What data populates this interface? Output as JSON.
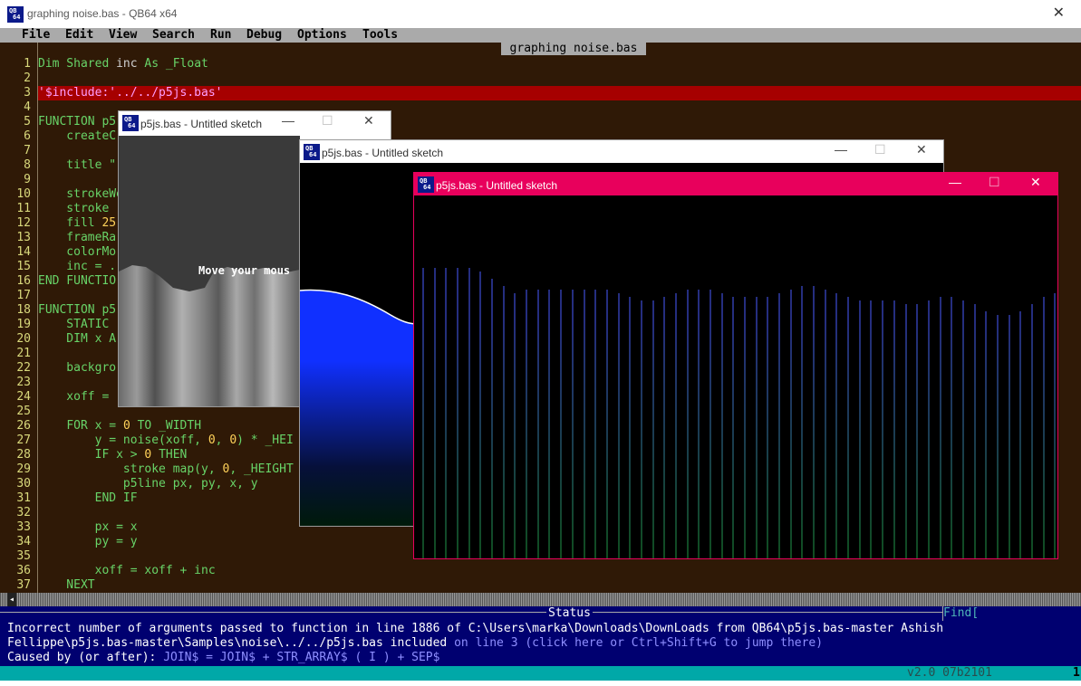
{
  "window": {
    "title": "graphing noise.bas - QB64 x64",
    "logo_top": "QB",
    "logo_bottom": "64",
    "close_glyph": "✕"
  },
  "menu": [
    "File",
    "Edit",
    "View",
    "Search",
    "Run",
    "Debug",
    "Options",
    "Tools"
  ],
  "editor": {
    "file_tab": "graphing noise.bas",
    "line_numbers": [
      "1",
      "2",
      "3",
      "4",
      "5",
      "6",
      "7",
      "8",
      "9",
      "10",
      "11",
      "12",
      "13",
      "14",
      "15",
      "16",
      "17",
      "18",
      "19",
      "20",
      "21",
      "22",
      "23",
      "24",
      "25",
      "26",
      "27",
      "28",
      "29",
      "30",
      "31",
      "32",
      "33",
      "34",
      "35",
      "36",
      "37"
    ],
    "lines": {
      "l1": [
        "Dim Shared ",
        "inc",
        " As _Float"
      ],
      "l3": "'$include:'../../p5js.bas'",
      "l5": "FUNCTION p5",
      "l6": "    createC",
      "l8": "    title \"",
      "l10": "    strokeWe",
      "l11": "    stroke ",
      "l12a": "    fill ",
      "l12b": "25",
      "l13": "    frameRa",
      "l14": "    colorMo",
      "l15": "    inc = .",
      "l16": "END FUNCTIO",
      "l18": "FUNCTION p5",
      "l19": "    STATIC ",
      "l20": "    DIM x A",
      "l22": "    backgro",
      "l24": "    xoff = ",
      "l26": [
        "    ",
        "FOR",
        " x = ",
        "0",
        " ",
        "TO",
        " _WIDTH"
      ],
      "l27": [
        "        y = noise(xoff, ",
        "0",
        ", ",
        "0",
        ") * _HEI"
      ],
      "l28": [
        "        ",
        "IF",
        " x > ",
        "0",
        " ",
        "THEN"
      ],
      "l29": [
        "            stroke map(y, ",
        "0",
        ", _HEIGHT"
      ],
      "l30": "            p5line px, py, x, y",
      "l31": "        END IF",
      "l33": "        px = x",
      "l34": "        py = y",
      "l36": "        xoff = xoff + inc",
      "l37": "    NEXT"
    }
  },
  "status": {
    "label": "Status",
    "find_label": "Find[",
    "line1": "Incorrect number of arguments passed to function in line 1886 of C:\\Users\\marka\\Downloads\\DownLoads from QB64\\p5js.bas-master Ashish",
    "line2a": "Fellippe\\p5js.bas-master\\Samples\\noise\\../../p5js.bas included ",
    "line2b": "on line 3 (click here or Ctrl+Shift+G to jump there)",
    "line3a": "Caused by (or after): ",
    "line3b": "JOIN$ = JOIN$ + STR_ARRAY$ ( I ) + SEP$"
  },
  "bottom_bar": {
    "version": "v2.0 07b2101",
    "column": "1"
  },
  "sketches": [
    {
      "title": "p5js.bas - Untitled sketch",
      "overlay_text": "Move your mous",
      "titlebar_color": "#ffffff"
    },
    {
      "title": "p5js.bas - Untitled sketch",
      "titlebar_color": "#ffffff"
    },
    {
      "title": "p5js.bas - Untitled sketch",
      "titlebar_color": "#e8005c"
    }
  ],
  "sketch_controls": {
    "minimize": "—",
    "maximize": "☐",
    "close": "✕"
  },
  "colors": {
    "editor_bg": "#2f1906",
    "keyword": "#68d468",
    "number": "#ffd25a",
    "string": "#ff9dff",
    "error_highlight": "#a60000",
    "status_bg": "#000070",
    "bottom_bar": "#00a8a8",
    "graph_line_top": "#4a5cff",
    "graph_line_bottom": "#1f9a3f"
  },
  "graph": {
    "levels": [
      0.8,
      0.8,
      0.8,
      0.8,
      0.8,
      0.79,
      0.77,
      0.75,
      0.73,
      0.74,
      0.74,
      0.74,
      0.74,
      0.74,
      0.74,
      0.74,
      0.74,
      0.73,
      0.72,
      0.71,
      0.71,
      0.72,
      0.73,
      0.74,
      0.74,
      0.74,
      0.73,
      0.72,
      0.72,
      0.72,
      0.72,
      0.73,
      0.74,
      0.75,
      0.75,
      0.74,
      0.73,
      0.72,
      0.71,
      0.71,
      0.71,
      0.71,
      0.7,
      0.7,
      0.71,
      0.72,
      0.72,
      0.71,
      0.7,
      0.68,
      0.67,
      0.67,
      0.68,
      0.7,
      0.72,
      0.73
    ]
  }
}
